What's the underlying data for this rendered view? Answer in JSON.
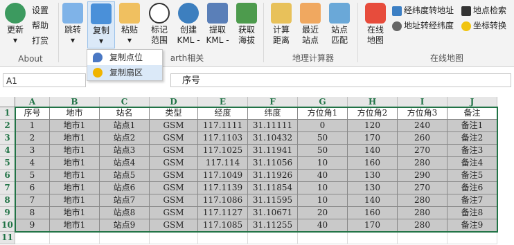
{
  "ribbon": {
    "about": {
      "small": [
        "设置",
        "帮助",
        "打赏"
      ],
      "update": "更新",
      "label": "About"
    },
    "buttons": [
      {
        "label": "跳转",
        "color": "#4a90d9"
      },
      {
        "label": "复制",
        "color": "#2e6db4"
      },
      {
        "label": "粘贴",
        "color": "#e6a23c"
      },
      {
        "label1": "标记",
        "label2": "范围",
        "color": "#555555"
      },
      {
        "label1": "创建",
        "label2": "KML -",
        "color": "#3a7d44"
      },
      {
        "label1": "提取",
        "label2": "KML -",
        "color": "#4a6fa5"
      },
      {
        "label1": "获取",
        "label2": "海拔",
        "color": "#3a8c3a"
      },
      {
        "label1": "计算",
        "label2": "距离",
        "color": "#d4a017"
      },
      {
        "label1": "最近",
        "label2": "站点",
        "color": "#e67e22"
      },
      {
        "label1": "站点",
        "label2": "匹配",
        "color": "#2980b9"
      },
      {
        "label1": "在线",
        "label2": "地图",
        "color": "#e74c3c"
      }
    ],
    "earth_group_label": "arth相关",
    "calc_group_label": "地理计算器",
    "online_group_label": "在线地图",
    "online_small": [
      "经纬度转地址",
      "地点检索",
      "地址转经纬度",
      "坐标转换"
    ]
  },
  "dropdown": {
    "items": [
      "复制点位",
      "复制扇区"
    ]
  },
  "formula": {
    "namebox": "A1",
    "content": "序号"
  },
  "columns": [
    "A",
    "B",
    "C",
    "D",
    "E",
    "F",
    "G",
    "H",
    "I",
    "J"
  ],
  "rows": [
    [
      "序号",
      "地市",
      "站名",
      "类型",
      "经度",
      "纬度",
      "方位角1",
      "方位角2",
      "方位角3",
      "备注"
    ],
    [
      "1",
      "地市1",
      "站点1",
      "GSM",
      "117.1111",
      "31.11111",
      "0",
      "120",
      "240",
      "备注1"
    ],
    [
      "2",
      "地市1",
      "站点2",
      "GSM",
      "117.1103",
      "31.10432",
      "50",
      "170",
      "260",
      "备注2"
    ],
    [
      "3",
      "地市1",
      "站点3",
      "GSM",
      "117.1025",
      "31.11941",
      "50",
      "140",
      "270",
      "备注3"
    ],
    [
      "4",
      "地市1",
      "站点4",
      "GSM",
      "117.114",
      "31.11056",
      "10",
      "160",
      "280",
      "备注4"
    ],
    [
      "5",
      "地市1",
      "站点5",
      "GSM",
      "117.1049",
      "31.11926",
      "40",
      "130",
      "290",
      "备注5"
    ],
    [
      "6",
      "地市1",
      "站点6",
      "GSM",
      "117.1139",
      "31.11854",
      "10",
      "130",
      "270",
      "备注6"
    ],
    [
      "7",
      "地市1",
      "站点7",
      "GSM",
      "117.1086",
      "31.11595",
      "10",
      "140",
      "280",
      "备注7"
    ],
    [
      "8",
      "地市1",
      "站点8",
      "GSM",
      "117.1127",
      "31.10671",
      "20",
      "160",
      "280",
      "备注8"
    ],
    [
      "9",
      "地市1",
      "站点9",
      "GSM",
      "117.1085",
      "31.11255",
      "40",
      "170",
      "280",
      "备注9"
    ]
  ],
  "row_numbers": [
    "1",
    "2",
    "3",
    "4",
    "5",
    "6",
    "7",
    "8",
    "9",
    "10",
    "11"
  ]
}
